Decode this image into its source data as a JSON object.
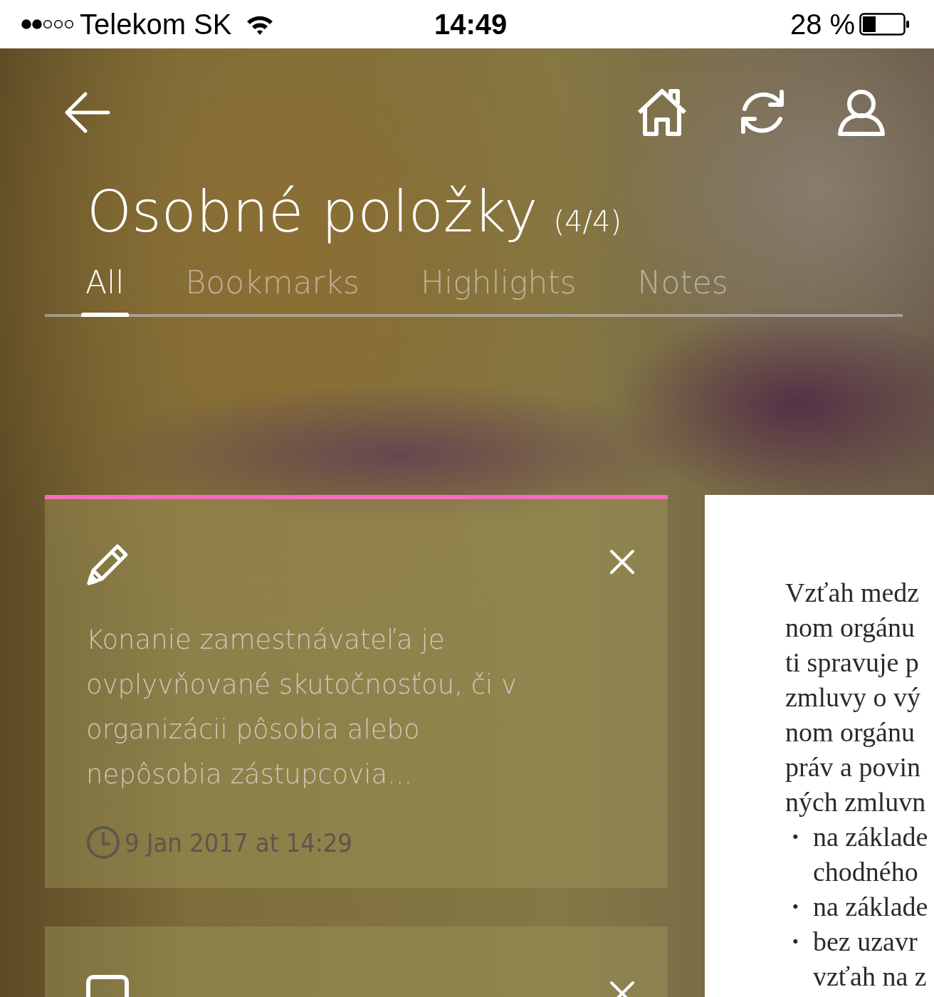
{
  "status_bar": {
    "carrier": "Telekom SK",
    "time": "14:49",
    "battery": "28 %"
  },
  "header": {
    "title": "Osobné položky",
    "count": "(4/4)"
  },
  "tabs": [
    {
      "label": "All",
      "selected": true
    },
    {
      "label": "Bookmarks",
      "selected": false
    },
    {
      "label": "Highlights",
      "selected": false
    },
    {
      "label": "Notes",
      "selected": false
    }
  ],
  "cards": [
    {
      "kind": "highlight",
      "color": "#f46dbb",
      "text": "Konanie zamestnávateľa je ovplyvňované skutočnosťou, či v organizácii pôsobia alebo nepôsobia zástupcovia...",
      "date": "9 Jan 2017 at 14:29"
    },
    {
      "kind": "note"
    }
  ],
  "document": {
    "lines": [
      {
        "kind": "text",
        "text": "Vzťah  medz"
      },
      {
        "kind": "text",
        "text": "nom orgánu"
      },
      {
        "kind": "text",
        "text": "ti spravuje p"
      },
      {
        "kind": "text",
        "text": "zmluvy o vý"
      },
      {
        "kind": "text",
        "text": "nom orgánu"
      },
      {
        "kind": "text",
        "text": "práv a povin"
      },
      {
        "kind": "text",
        "text": "ných zmluvn"
      },
      {
        "kind": "bullet",
        "marker": "·",
        "text": "na  základe"
      },
      {
        "kind": "cont",
        "text": "chodného"
      },
      {
        "kind": "bullet",
        "marker": "·",
        "text": "na základe"
      },
      {
        "kind": "bullet",
        "marker": "·",
        "text": "bez  uzavr"
      },
      {
        "kind": "cont",
        "text": "vzťah na z"
      }
    ]
  }
}
